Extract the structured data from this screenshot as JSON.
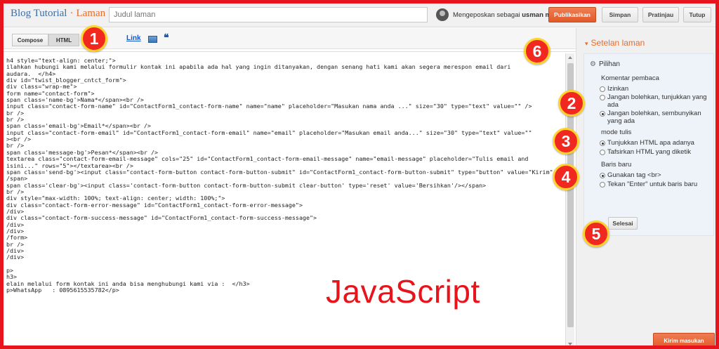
{
  "header": {
    "brand": "Blog Tutorial",
    "separator": "·",
    "section": "Laman",
    "title_placeholder": "Judul laman",
    "posting_as": "Mengeposkan sebagai",
    "user": "usman mr",
    "publish_label": "Publikasikan",
    "save_label": "Simpan",
    "preview_label": "Pratinjau",
    "close_label": "Tutup"
  },
  "toolbar": {
    "compose_label": "Compose",
    "html_label": "HTML",
    "link_label": "Link",
    "quote_glyph": "❝"
  },
  "editor": {
    "code_lines": [
      "h4 style=\"text-align: center;\">",
      "ilahkan hubungi kami melalui formulir kontak ini apabila ada hal yang ingin ditanyakan, dengan senang hati kami akan segera merespon email dari",
      "audara.  </h4>",
      "div id=\"twist_blogger_cntct_form\">",
      "div class=\"wrap-me\">",
      "form name=\"contact-form\">",
      "span class='name-bg'>Nama*</span><br />",
      "input class=\"contact-form-name\" id=\"ContactForm1_contact-form-name\" name=\"name\" placeholder=\"Masukan nama anda ...\" size=\"30\" type=\"text\" value=\"\" />",
      "br />",
      "br />",
      "span class='email-bg'>Email*</span><br />",
      "input class=\"contact-form-email\" id=\"ContactForm1_contact-form-email\" name=\"email\" placeholder=\"Masukan email anda...\" size=\"30\" type=\"text\" value=\"\"",
      "><br />",
      "br />",
      "span class='message-bg'>Pesan*</span><br />",
      "textarea class=\"contact-form-email-message\" cols=\"25\" id=\"ContactForm1_contact-form-email-message\" name=\"email-message\" placeholder=\"Tulis email and",
      "isini...\" rows=\"5\"></textarea><br />",
      "span class='send-bg'><input class=\"contact-form-button contact-form-button-submit\" id=\"ContactForm1_contact-form-button-submit\" type=\"button\" value=\"Kirim\" />",
      "/span>",
      "span class='clear-bg'><input class='contact-form-button contact-form-button-submit clear-button' type='reset' value='Bersihkan'/></span>",
      "br />",
      "div style=\"max-width: 100%; text-align: center; width: 100%;\">",
      "div class=\"contact-form-error-message\" id=\"ContactForm1_contact-form-error-message\">",
      "/div>",
      "div class=\"contact-form-success-message\" id=\"ContactForm1_contact-form-success-message\">",
      "/div>",
      "/div>",
      "/form>",
      "br />",
      "/div>",
      "/div>",
      "",
      "p>",
      "h3>",
      "elain melalui form kontak ini anda bisa menghubungi kami via :  </h3>",
      "p>WhatsApp   : 0895615535782</p>"
    ]
  },
  "sidebar": {
    "heading": "Setelan laman",
    "options_title": "Pilihan",
    "comments_label": "Komentar pembaca",
    "comments_options": [
      {
        "label": "Izinkan",
        "checked": false
      },
      {
        "label": "Jangan bolehkan, tunjukkan yang ada",
        "checked": false
      },
      {
        "label": "Jangan bolehkan, sembunyikan yang ada",
        "checked": true
      }
    ],
    "write_mode_label": "mode tulis",
    "write_mode_options": [
      {
        "label": "Tunjukkan HTML apa adanya",
        "checked": true
      },
      {
        "label": "Tafsirkan HTML yang diketik",
        "checked": false
      }
    ],
    "line_break_label": "Baris baru",
    "line_break_options": [
      {
        "label": "Gunakan tag <br>",
        "checked": true
      },
      {
        "label": "Tekan \"Enter\" untuk baris baru",
        "checked": false
      }
    ],
    "done_label": "Selesai",
    "feedback_label": "Kirim masukan"
  },
  "annotations": {
    "badges": [
      "1",
      "2",
      "3",
      "4",
      "5",
      "6"
    ],
    "watermark": "JavaScript",
    "colors": {
      "badge": "#f1281f",
      "badge_ring": "#ffd22e",
      "frame": "#e8141b",
      "accent": "#e76c2a"
    }
  }
}
